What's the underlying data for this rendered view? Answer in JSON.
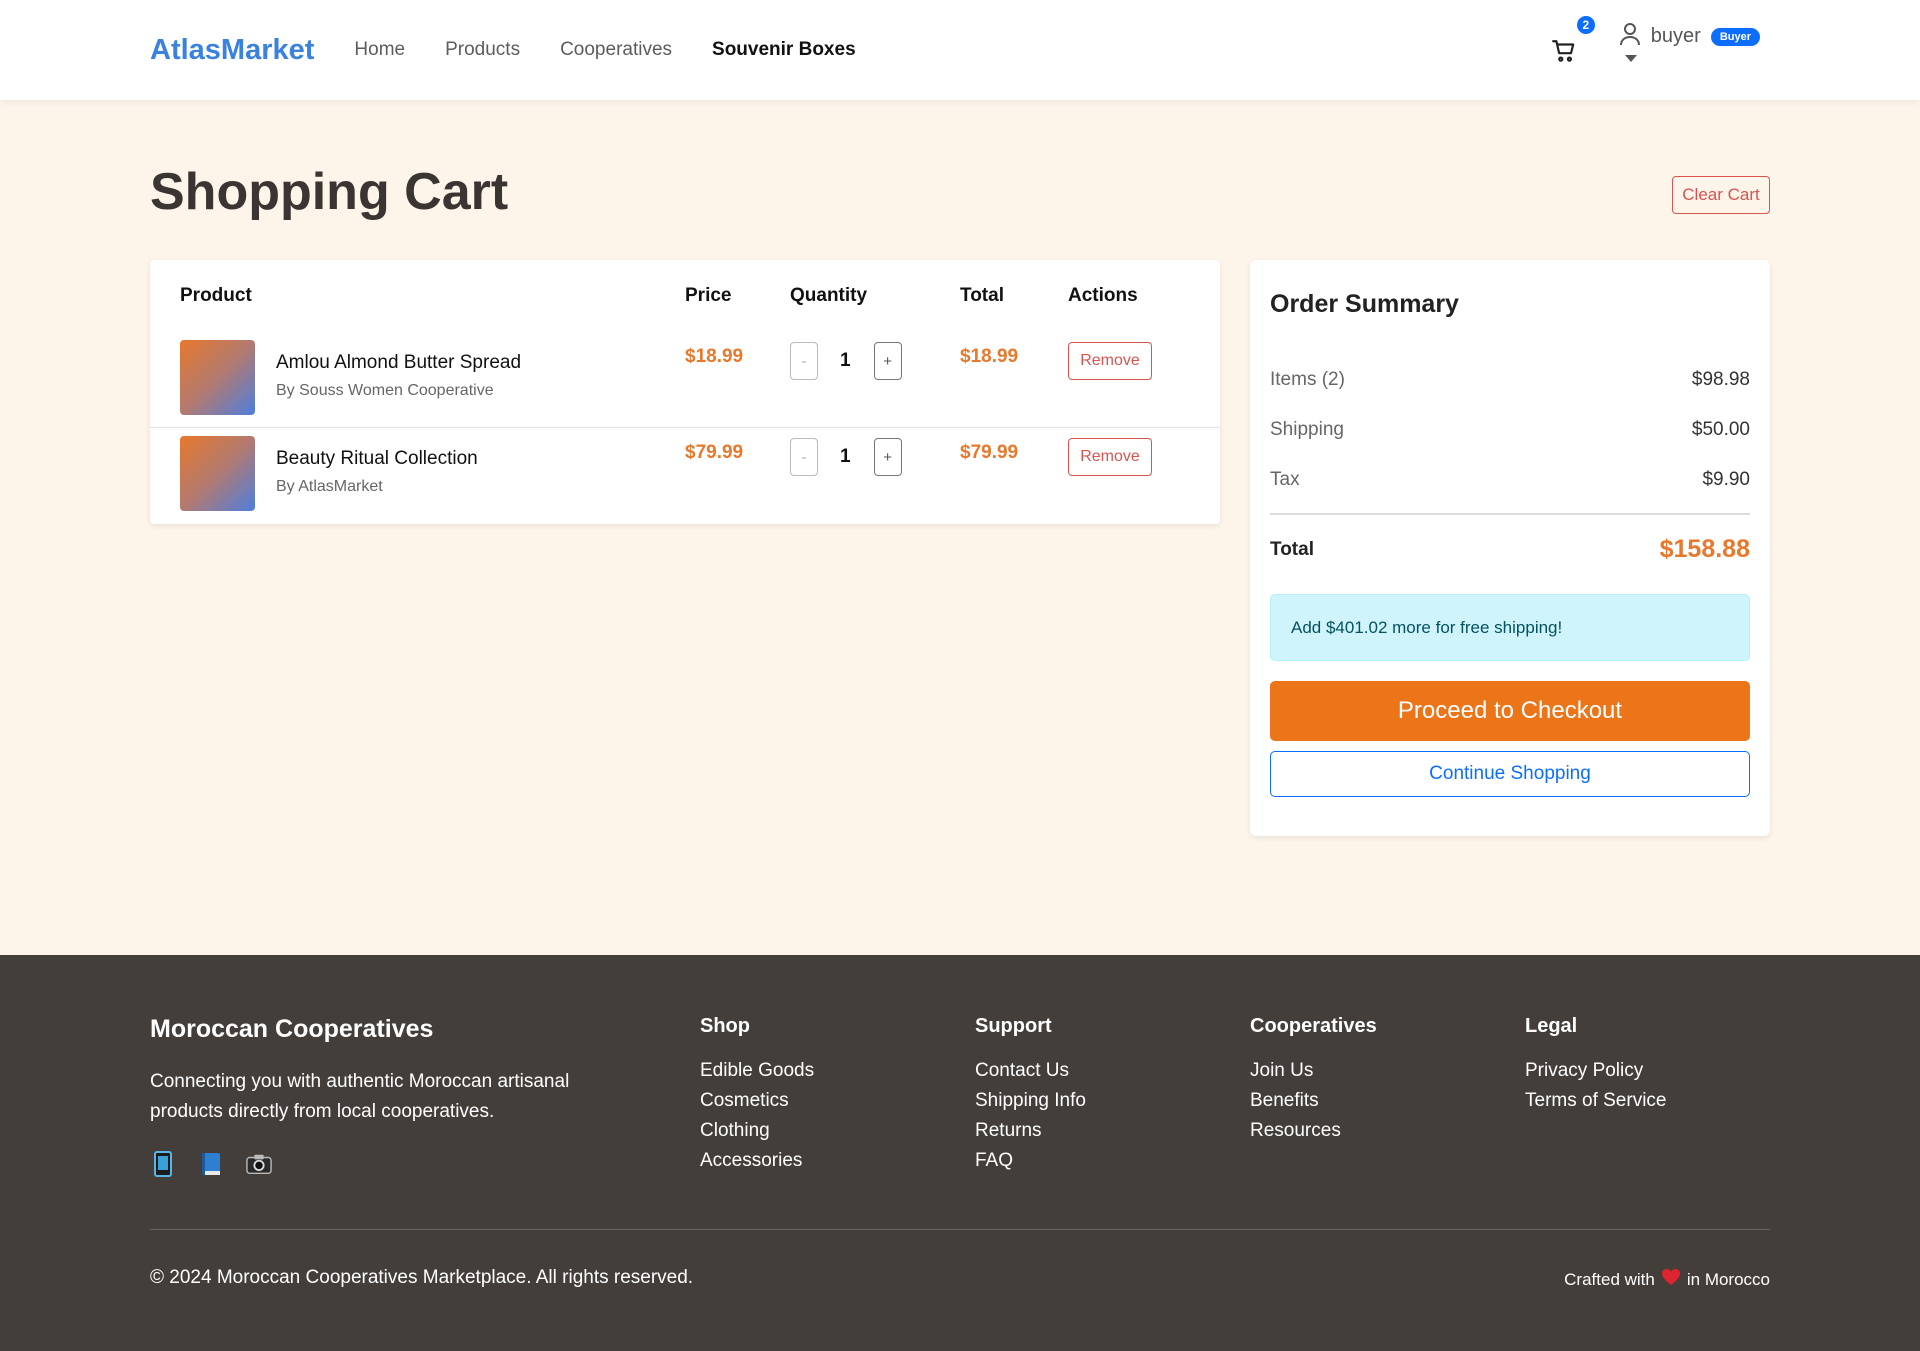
{
  "navbar": {
    "brand": "AtlasMarket",
    "links": [
      "Home",
      "Products",
      "Cooperatives",
      "Souvenir Boxes"
    ],
    "active_link": "Souvenir Boxes",
    "cart_count": "2",
    "user_name": "buyer",
    "role_badge": "Buyer"
  },
  "page": {
    "title": "Shopping Cart",
    "clear_button": "Clear Cart"
  },
  "cart": {
    "headers": {
      "product": "Product",
      "price": "Price",
      "quantity": "Quantity",
      "total": "Total",
      "actions": "Actions"
    },
    "items": [
      {
        "name": "Amlou Almond Butter Spread",
        "by": "By Souss Women Cooperative",
        "price": "$18.99",
        "quantity": "1",
        "total": "$18.99",
        "minus": "-",
        "plus": "+",
        "remove": "Remove"
      },
      {
        "name": "Beauty Ritual Collection",
        "by": "By AtlasMarket",
        "price": "$79.99",
        "quantity": "1",
        "total": "$79.99",
        "minus": "-",
        "plus": "+",
        "remove": "Remove"
      }
    ]
  },
  "summary": {
    "title": "Order Summary",
    "items_label": "Items (2)",
    "items_value": "$98.98",
    "shipping_label": "Shipping",
    "shipping_value": "$50.00",
    "tax_label": "Tax",
    "tax_value": "$9.90",
    "total_label": "Total",
    "total_value": "$158.88",
    "free_shipping_msg": "Add $401.02 more for free shipping!",
    "checkout_button": "Proceed to Checkout",
    "continue_button": "Continue Shopping"
  },
  "footer": {
    "brand": "Moroccan Cooperatives",
    "description": "Connecting you with authentic Moroccan artisanal products directly from local cooperatives.",
    "social_icons": [
      "phone-icon",
      "book-icon",
      "camera-icon"
    ],
    "columns": [
      {
        "title": "Shop",
        "links": [
          "Edible Goods",
          "Cosmetics",
          "Clothing",
          "Accessories"
        ]
      },
      {
        "title": "Support",
        "links": [
          "Contact Us",
          "Shipping Info",
          "Returns",
          "FAQ"
        ]
      },
      {
        "title": "Cooperatives",
        "links": [
          "Join Us",
          "Benefits",
          "Resources"
        ]
      },
      {
        "title": "Legal",
        "links": [
          "Privacy Policy",
          "Terms of Service"
        ]
      }
    ],
    "copyright": "© 2024 Moroccan Cooperatives Marketplace. All rights reserved.",
    "crafted_prefix": "Crafted with",
    "crafted_suffix": "in Morocco"
  },
  "colors": {
    "brand": "#3a82e0",
    "accent": "#e8782c",
    "danger": "#d9534f",
    "footer_bg": "#433e3a"
  }
}
